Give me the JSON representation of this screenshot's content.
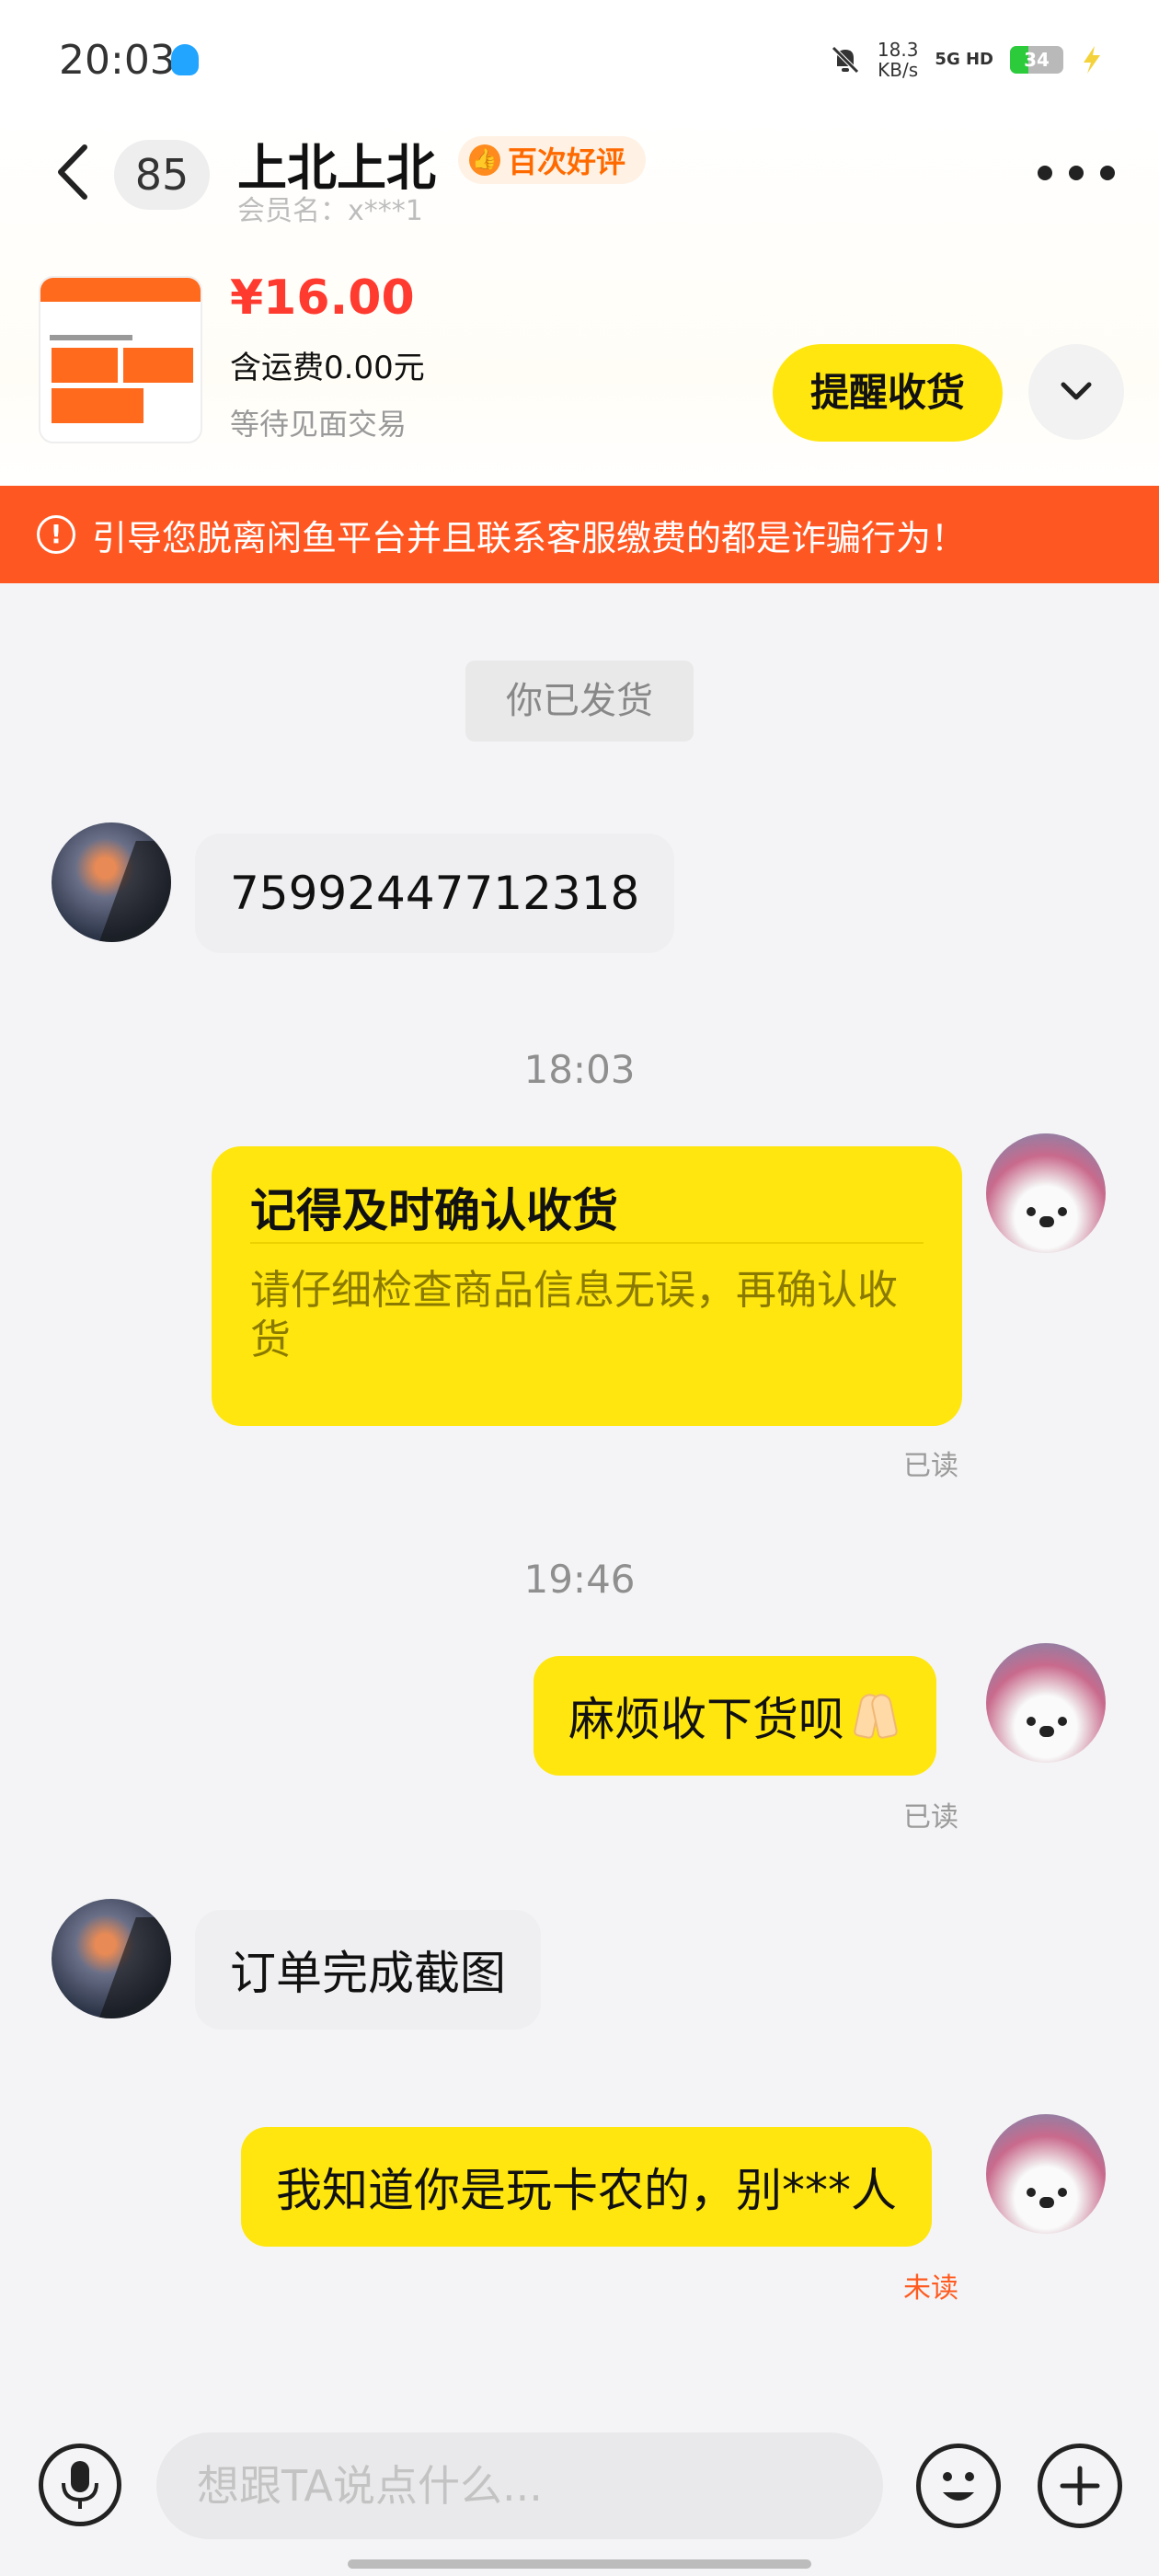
{
  "status_bar": {
    "time": "20:03",
    "net_speed_value": "18.3",
    "net_speed_unit": "KB/s",
    "network": "5G HD",
    "battery": "34",
    "battery_level": 0.34
  },
  "header": {
    "unread_count": "85",
    "user_name": "上北上北",
    "review_badge": "百次好评",
    "member_name": "会员名：x***1"
  },
  "product": {
    "price": "¥16.00",
    "shipping": "含运费0.00元",
    "status": "等待见面交易",
    "remind_button": "提醒收货"
  },
  "warning": {
    "icon": "!",
    "text": "引导您脱离闲鱼平台并且联系客服缴费的都是诈骗行为！"
  },
  "messages": {
    "system_shipped": "你已发货",
    "seller_msg_1": "75992447712318",
    "time_1": "18:03",
    "card_title": "记得及时确认收货",
    "card_body": "请仔细检查商品信息无误，再确认收货",
    "read_1": "已读",
    "time_2": "19:46",
    "my_msg_2": "麻烦收下货呗",
    "read_2": "已读",
    "seller_msg_2": "订单完成截图",
    "my_msg_3": "我知道你是玩卡农的，别***人",
    "read_3": "未读"
  },
  "input": {
    "placeholder": "想跟TA说点什么..."
  },
  "colors": {
    "accent_yellow": "#ffe60f",
    "warning_orange": "#ff5722",
    "price_red": "#ff3a2f"
  }
}
